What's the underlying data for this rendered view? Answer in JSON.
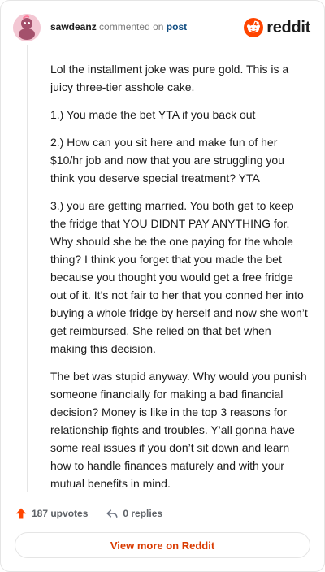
{
  "header": {
    "username": "sawdeanz",
    "commented_text": "commented on",
    "post_link": "post"
  },
  "brand": {
    "name": "reddit",
    "icon": "reddit-logo-icon"
  },
  "comment": {
    "paragraphs": [
      "Lol the installment joke was pure gold. This is a juicy three-tier asshole cake.",
      "1.) You made the bet YTA if you back out",
      "2.) How can you sit here and make fun of her $10/hr job and now that you are struggling you think you deserve special treatment? YTA",
      "3.) you are getting married. You both get to keep the fridge that YOU DIDNT PAY ANYTHING for. Why should she be the one paying for the whole thing? I think you forget that you made the bet because you thought you would get a free fridge out of it. It’s not fair to her that you conned her into buying a whole fridge by herself and now she won’t get reimbursed. She relied on that bet when making this decision.",
      "The bet was stupid anyway. Why would you punish someone financially for making a bad financial decision? Money is like in the top 3 reasons for relationship fights and troubles. Y’all gonna have some real issues if you don’t sit down and learn how to handle finances maturely and with your mutual benefits in mind."
    ]
  },
  "footer": {
    "upvotes": "187 upvotes",
    "replies": "0 replies",
    "upvote_icon": "upvote-arrow-icon",
    "reply_icon": "reply-arrow-icon"
  },
  "actions": {
    "view_more_label": "View more on Reddit"
  },
  "colors": {
    "accent": "#ff4500",
    "button_text": "#d93a00",
    "post_link": "#0f4c81",
    "avatar_bg": "#f3c7d3"
  }
}
